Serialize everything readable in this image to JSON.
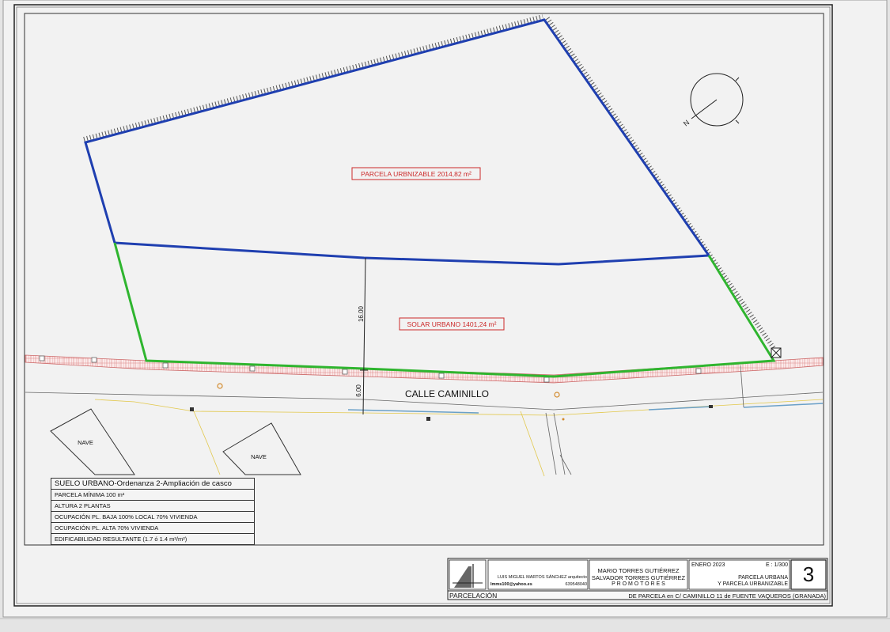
{
  "plan": {
    "areas": {
      "urbanizable": "PARCELA URBNIZABLE 2014,82 m²",
      "urbano": "SOLAR URBANO  1401,24 m²"
    },
    "street": "CALLE CAMINILLO",
    "dimensions": {
      "depth": "16.00",
      "street_width": "6.00"
    },
    "buildings": [
      "NAVE",
      "NAVE"
    ],
    "north_label": "N",
    "colors": {
      "blue": "#1f3fb0",
      "green": "#2fb52f",
      "red": "#cc2a2a"
    }
  },
  "legend": {
    "title": "SUELO URBANO-Ordenanza 2-Ampliación de casco",
    "rows": [
      "PARCELA MÍNIMA 100 m²",
      "ALTURA  2 PLANTAS",
      "OCUPACIÓN PL. BAJA     100% LOCAL 70% VIVIENDA",
      "OCUPACIÓN PL. ALTA     70% VIVIENDA",
      "EDIFICABILIDAD  RESULTANTE (1.7  ó  1.4  m²/m²)"
    ]
  },
  "title_block": {
    "architect": "LUIS MIGUEL MARTOS SÁNCHEZ arquitecto",
    "email": "lmms100@yahoo.es",
    "phone": "639548040",
    "promoters": [
      "MARIO TORRES GUTIÉRREZ",
      "SALVADOR TORRES GUTIÉRREZ",
      "P R O M O T O R E S"
    ],
    "date": "ENERO 2023",
    "scale": "E : 1/300",
    "description": [
      "PARCELA URBANA",
      "Y PARCELA URBANIZABLE"
    ],
    "sheet_number": "3",
    "section": "PARCELACIÓN",
    "subject": "DE PARCELA en C/ CAMINILLO 11 de FUENTE VAQUEROS (GRANADA)"
  }
}
